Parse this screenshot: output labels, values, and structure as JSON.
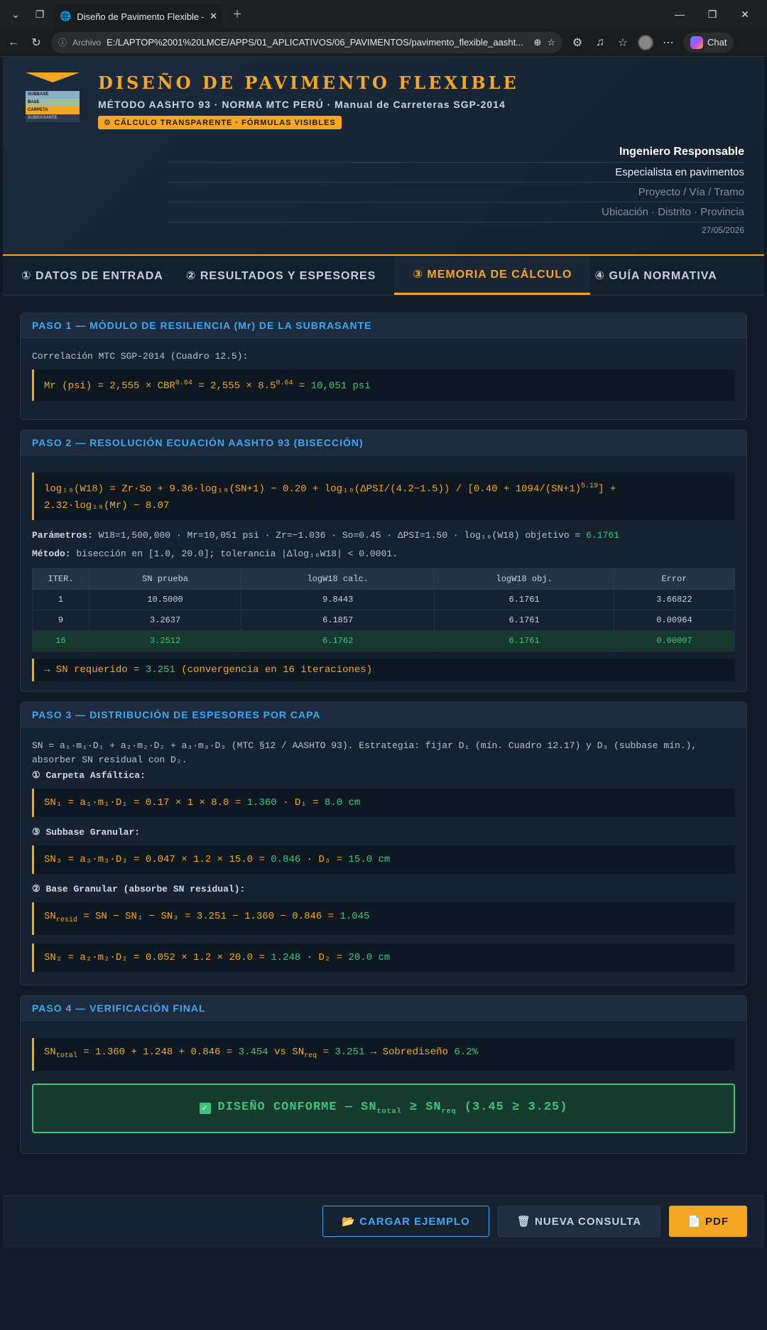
{
  "browser": {
    "tab_title": "Diseño de Pavimento Flexible — A",
    "url_label": "Archivo",
    "url": "E:/LAPTOP%2001%20LMCE/APPS/01_APLICATIVOS/06_PAVIMENTOS/pavimento_flexible_aasht...",
    "chat_label": "Chat"
  },
  "header": {
    "title": "DISEÑO DE PAVIMENTO FLEXIBLE",
    "subtitle": "MÉTODO AASHTO 93 · NORMA MTC PERÚ · Manual de Carreteras SGP-2014",
    "badge": "⚙ CÁLCULO TRANSPARENTE · FÓRMULAS VISIBLES",
    "logo_layers": [
      "SUBBASE",
      "BASE",
      "CARPETA",
      "SUBRASANTE"
    ],
    "engineer": "Ingeniero Responsable",
    "specialty": "Especialista en pavimentos",
    "project_placeholder": "Proyecto / Vía / Tramo",
    "location_placeholder": "Ubicación · Distrito · Provincia",
    "date": "27/05/2026"
  },
  "tabs": [
    "① DATOS DE ENTRADA",
    "② RESULTADOS Y ESPESORES",
    "③ MEMORIA DE CÁLCULO",
    "④ GUÍA NORMATIVA"
  ],
  "paso1": {
    "title": "PASO 1 — MÓDULO DE RESILIENCIA (Mr) DE LA SUBRASANTE",
    "intro": "Correlación MTC SGP-2014 (Cuadro 12.5):",
    "formula_a": "Mr (psi) = 2,555 × CBR",
    "exp": "0.64",
    "formula_b": " = 2,555 × 8.5",
    "formula_c": " = ",
    "result": "10,051 psi"
  },
  "paso2": {
    "title": "PASO 2 — RESOLUCIÓN ECUACIÓN AASHTO 93 (BISECCIÓN)",
    "formula_1": "log₁₀(W18) = Zr·So + 9.36·log₁₀(SN+1) − 0.20 + log₁₀(ΔPSI/(4.2−1.5)) / [0.40 + 1094/(SN+1)",
    "formula_exp": "5.19",
    "formula_2": "] +",
    "formula_3": "2.32·log₁₀(Mr) − 8.07",
    "params_label": "Parámetros:",
    "params": " W18=1,500,000 · Mr=10,051 psi · Zr=−1.036 · So=0.45 · ΔPSI=1.50 · log₁₀(W18) objetivo = ",
    "params_target": "6.1761",
    "method_label": "Método:",
    "method": " bisección en [1.0, 20.0]; tolerancia |Δlog₁₀W18| < 0.0001.",
    "table_headers": [
      "ITER.",
      "SN prueba",
      "logW18 calc.",
      "logW18 obj.",
      "Error"
    ],
    "rows": [
      [
        "1",
        "10.5000",
        "9.8443",
        "6.1761",
        "3.66822"
      ],
      [
        "9",
        "3.2637",
        "6.1857",
        "6.1761",
        "0.00964"
      ],
      [
        "16",
        "3.2512",
        "6.1762",
        "6.1761",
        "0.00007"
      ]
    ],
    "result_a": "→ SN requerido = ",
    "result_val": "3.251",
    "result_b": " (convergencia en 16 iteraciones)"
  },
  "paso3": {
    "title": "PASO 3 — DISTRIBUCIÓN DE ESPESORES POR CAPA",
    "intro": "SN = a₁·m₁·D₁ + a₂·m₂·D₂ + a₃·m₃·D₃ (MTC §12 / AASHTO 93). Estrategia: fijar D₁ (mín. Cuadro 12.17) y D₃ (subbase mín.), absorber SN residual con D₂.",
    "l1": "① Carpeta Asfáltica:",
    "f1a": "SN₁ = a₁·m₁·D₁ = 0.17 × 1 × 8.0 = ",
    "f1v": "1.360",
    "f1b": " · D₁ = ",
    "f1d": "8.0 cm",
    "l3": "③ Subbase Granular:",
    "f3a": "SN₃ = a₃·m₃·D₃ = 0.047 × 1.2 × 15.0 = ",
    "f3v": "0.846",
    "f3b": " · D₃ = ",
    "f3d": "15.0 cm",
    "l2": "② Base Granular (absorbe SN residual):",
    "fr_a": "SN",
    "fr_sub": "resid",
    "fr_b": " = SN − SN₁ − SN₃ = 3.251 − 1.360 − 0.846 = ",
    "fr_v": "1.045",
    "f2a": "SN₂ = a₂·m₂·D₂ = 0.052 × 1.2 × 20.0 = ",
    "f2v": "1.248",
    "f2b": " · D₂ = ",
    "f2d": "20.0 cm"
  },
  "paso4": {
    "title": "PASO 4 — VERIFICACIÓN FINAL",
    "f_a": "SN",
    "f_sub1": "total",
    "f_b": " = 1.360 + 1.248 + 0.846 = ",
    "f_v1": "3.454",
    "f_c": " vs SN",
    "f_sub2": "req",
    "f_d": " = ",
    "f_v2": "3.251",
    "f_e": " → Sobrediseño ",
    "f_v3": "6.2%",
    "ok_a": "DISEÑO CONFORME — SN",
    "ok_sub1": "total",
    "ok_b": " ≥ SN",
    "ok_sub2": "req",
    "ok_c": " (3.45 ≥ 3.25)"
  },
  "footer": {
    "load": "📂 CARGAR EJEMPLO",
    "new": "🗑 NUEVA CONSULTA",
    "pdf": "📄 PDF"
  },
  "colors": {
    "accent": "#f5a623",
    "blue": "#3fa8f0",
    "green": "#3ec47a"
  }
}
